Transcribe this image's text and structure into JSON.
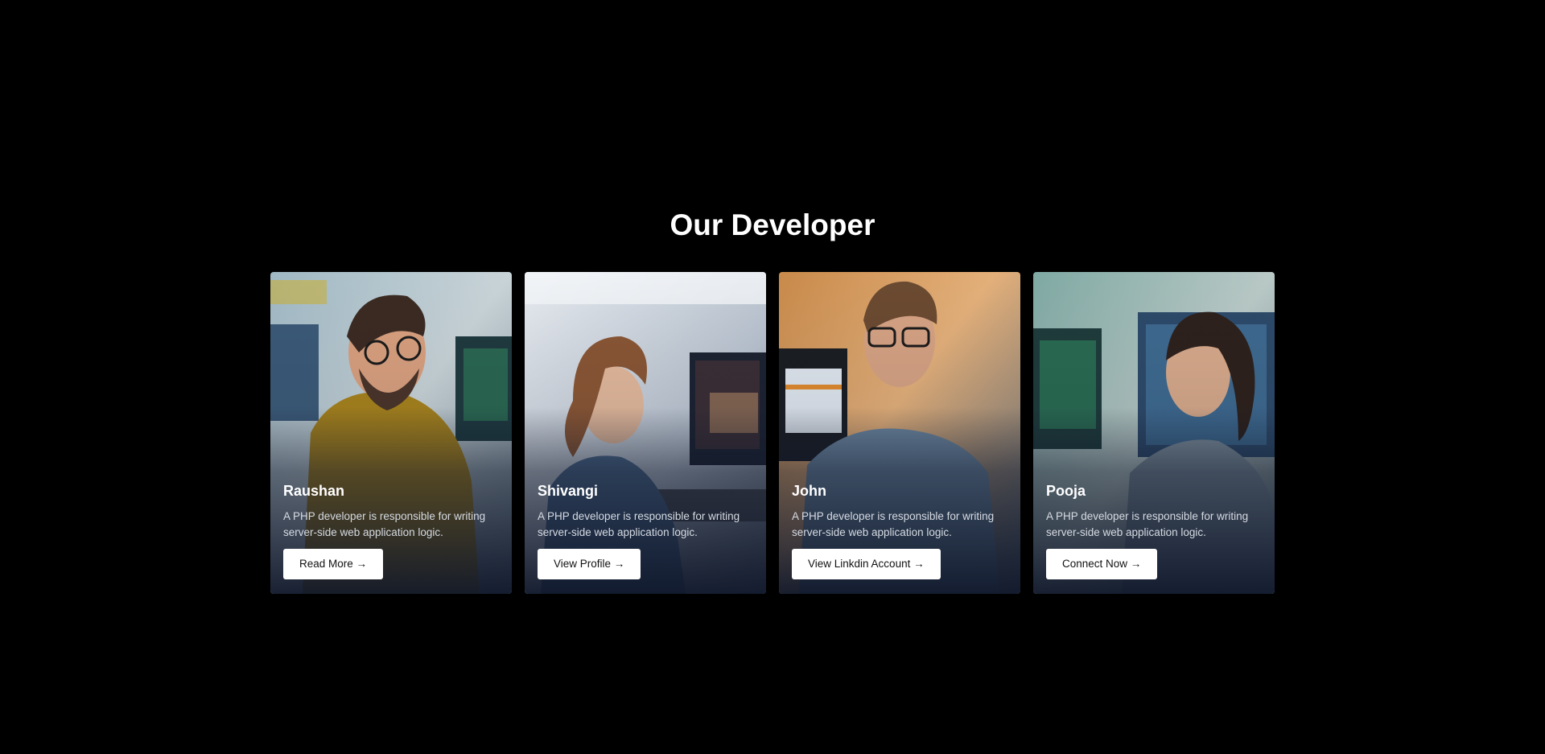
{
  "section": {
    "title": "Our Developer"
  },
  "developers": [
    {
      "name": "Raushan",
      "description": "A PHP developer is responsible for writing server-side web application logic.",
      "button_label": "Read More →"
    },
    {
      "name": "Shivangi",
      "description": "A PHP developer is responsible for writing server-side web application logic.",
      "button_label": "View Profile →"
    },
    {
      "name": "John",
      "description": "A PHP developer is responsible for writing server-side web application logic.",
      "button_label": "View Linkdin Account →"
    },
    {
      "name": "Pooja",
      "description": "A PHP developer is responsible for writing server-side web application logic.",
      "button_label": "Connect Now →"
    }
  ],
  "colors": {
    "page_background": "#000000",
    "card_overlay": "#0f172a",
    "button_background": "#ffffff",
    "button_text": "#111111",
    "heading_text": "#ffffff"
  }
}
